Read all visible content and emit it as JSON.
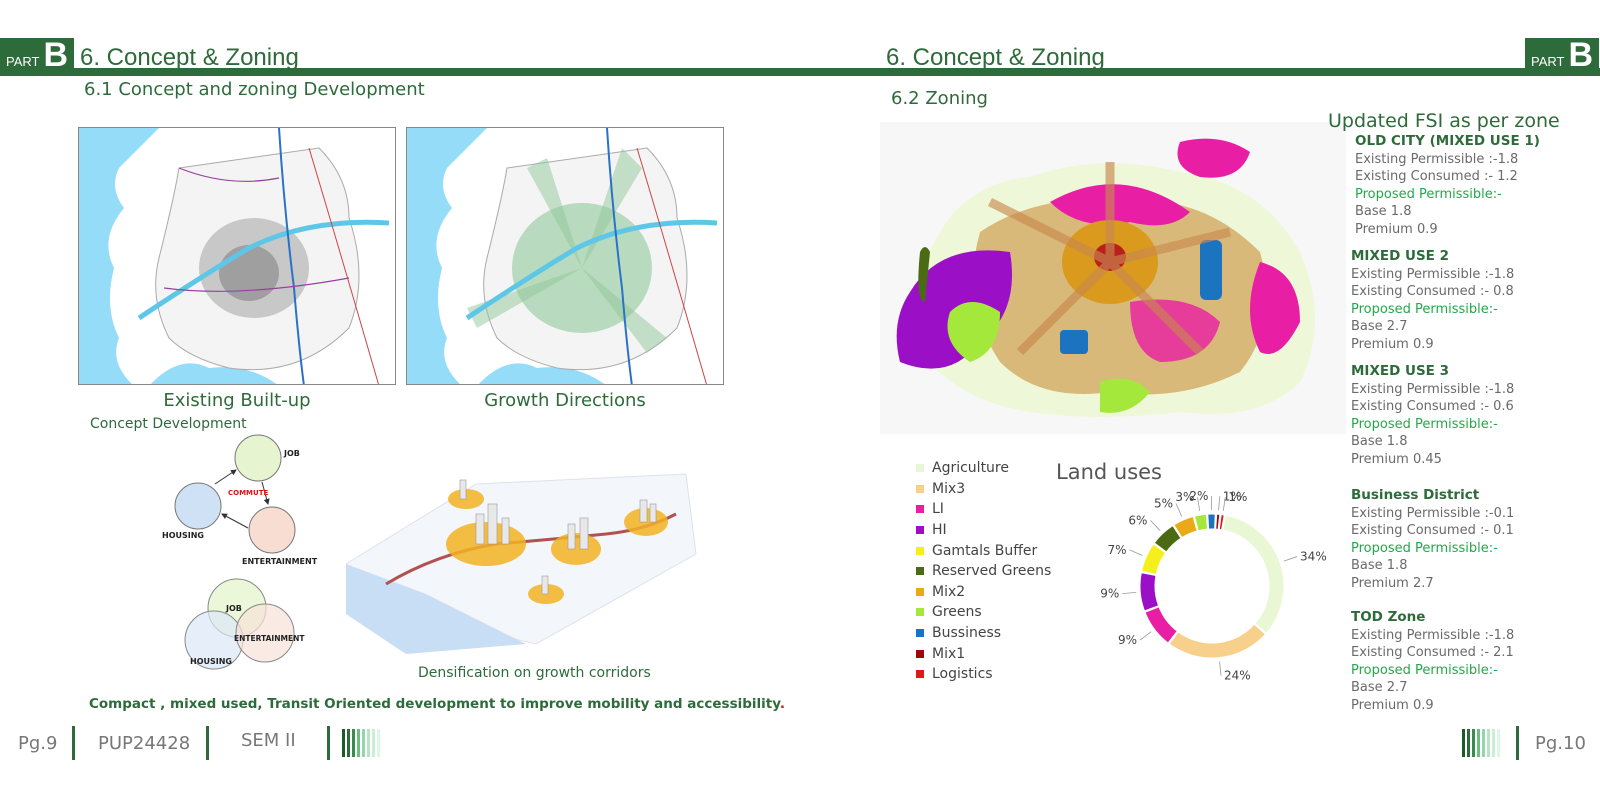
{
  "left_page": {
    "part_label_small": "PART",
    "part_label_big": "B",
    "heading": "6. Concept & Zoning",
    "subheading": "6.1 Concept and zoning Development",
    "map1_caption": "Existing Built-up",
    "map2_caption": "Growth Directions",
    "concept_label": "Concept Development",
    "diagram1": {
      "job": "JOB",
      "commute": "COMMUTE",
      "housing": "HOUSING",
      "entertainment": "ENTERTAINMENT"
    },
    "diagram2": {
      "job": "JOB",
      "housing": "HOUSING",
      "entertainment": "ENTERTAINMENT"
    },
    "densification_caption": "Densification on growth corridors",
    "statement": "Compact , mixed used, Transit Oriented development to improve mobility and accessibility",
    "footer": {
      "page": "Pg.9",
      "code": "PUP24428",
      "sem": "SEM II"
    }
  },
  "right_page": {
    "part_label_small": "PART",
    "part_label_big": "B",
    "heading": "6. Concept & Zoning",
    "subheading": "6.2 Zoning",
    "fsi_title": "Updated FSI as per zone",
    "zones": [
      {
        "name": "OLD CITY (MIXED USE 1)",
        "existing_permissible": "Existing Permissible :-1.8",
        "existing_consumed": "Existing Consumed :-  1.2",
        "proposed": "Proposed Permissible:-",
        "base": "Base 1.8",
        "premium": "Premium 0.9"
      },
      {
        "name": "MIXED USE 2",
        "existing_permissible": "Existing Permissible :-1.8",
        "existing_consumed": "Existing Consumed :-  0.8",
        "proposed": "Proposed Permissible:-",
        "base": "Base 2.7",
        "premium": "Premium 0.9"
      },
      {
        "name": "MIXED USE 3",
        "existing_permissible": "Existing Permissible :-1.8",
        "existing_consumed": "Existing Consumed :-  0.6",
        "proposed": "Proposed Permissible:-",
        "base": "Base 1.8",
        "premium": "Premium 0.45"
      },
      {
        "name": "Business District",
        "existing_permissible": "Existing Permissible :-0.1",
        "existing_consumed": "Existing Consumed :-  0.1",
        "proposed": "Proposed Permissible:-",
        "base": "Base 1.8",
        "premium": "Premium 2.7"
      },
      {
        "name": "TOD Zone",
        "existing_permissible": "Existing Permissible :-1.8",
        "existing_consumed": "Existing Consumed :-  2.1",
        "proposed": "Proposed Permissible:-",
        "base": "Base 2.7",
        "premium": "Premium 0.9"
      }
    ],
    "footer": {
      "page": "Pg.10"
    }
  },
  "colors": {
    "brand_green": "#2e6b3a",
    "accent_green": "#21a94a"
  },
  "chart_data": {
    "type": "pie",
    "title": "Land uses",
    "categories": [
      "Agriculture",
      "Mix3",
      "LI",
      "HI",
      "Gamtals Buffer",
      "Reserved Greens",
      "Mix2",
      "Greens",
      "Bussiness",
      "Mix1",
      "Logistics"
    ],
    "values": [
      34,
      24,
      9,
      9,
      7,
      6,
      5,
      3,
      2,
      1,
      1
    ],
    "value_labels": [
      "34%",
      "24%",
      "9%",
      "9%",
      "7%",
      "6%",
      "5%",
      "3%",
      "2%",
      "1%",
      "1%"
    ],
    "colors": [
      "#eaf7d5",
      "#f7d08c",
      "#e81ea4",
      "#9b10c6",
      "#f5f01c",
      "#4a6b14",
      "#eaaa18",
      "#a3e83a",
      "#1c74c0",
      "#9a0a0a",
      "#e01818"
    ],
    "legend_position": "left",
    "donut": true
  }
}
